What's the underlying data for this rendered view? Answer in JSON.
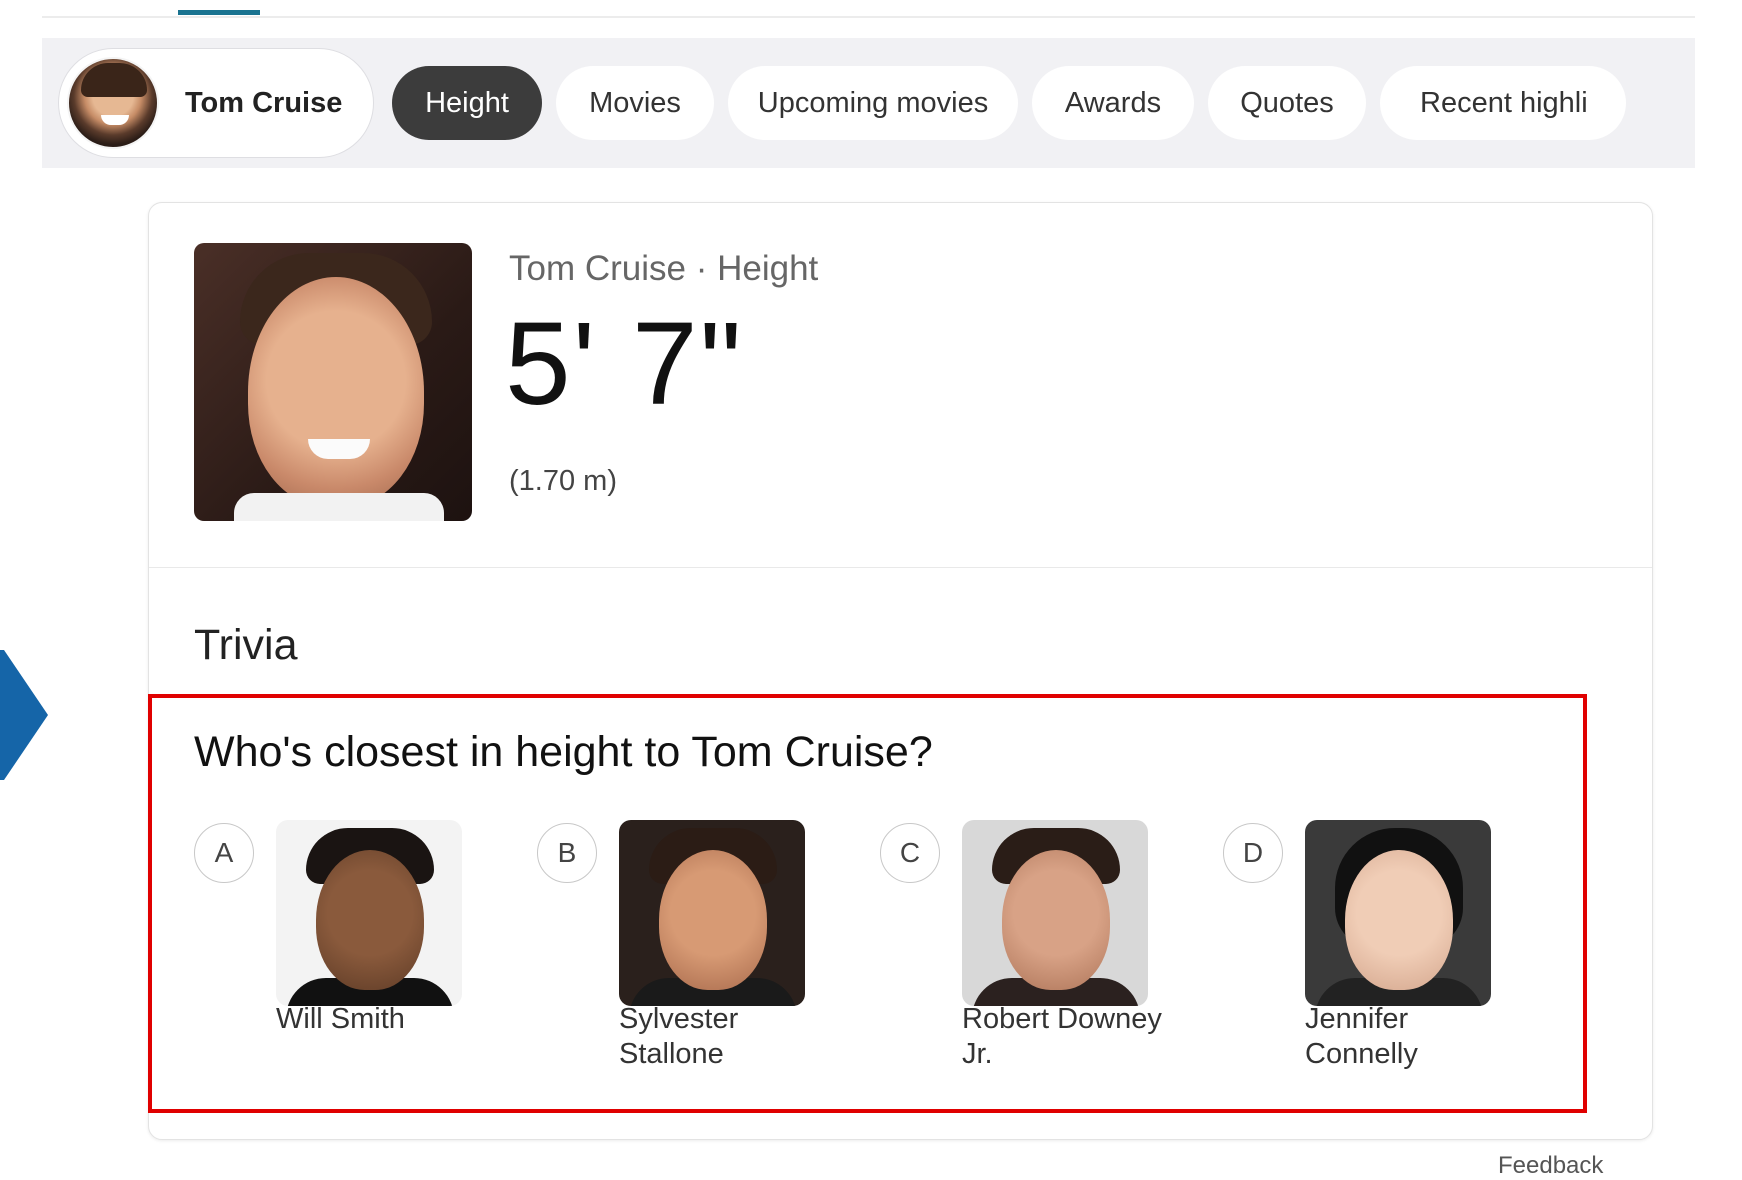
{
  "entity": {
    "name": "Tom Cruise"
  },
  "tabs": [
    {
      "label": "Height",
      "active": true
    },
    {
      "label": "Movies",
      "active": false
    },
    {
      "label": "Upcoming movies",
      "active": false
    },
    {
      "label": "Awards",
      "active": false
    },
    {
      "label": "Quotes",
      "active": false
    },
    {
      "label": "Recent highli",
      "active": false
    }
  ],
  "hero": {
    "caption": "Tom Cruise · Height",
    "value": "5' 7\"",
    "metric": "(1.70 m)"
  },
  "trivia": {
    "title": "Trivia",
    "question": "Who's closest in height to Tom Cruise?",
    "options": [
      {
        "letter": "A",
        "name": "Will Smith"
      },
      {
        "letter": "B",
        "name": "Sylvester Stallone"
      },
      {
        "letter": "C",
        "name": "Robert Downey Jr."
      },
      {
        "letter": "D",
        "name": "Jennifer Connelly"
      }
    ]
  },
  "footer": {
    "feedback": "Feedback"
  },
  "colors": {
    "active_tab": "#3c3c3c",
    "highlight_border": "#e00000",
    "accent_indicator": "#1a7390",
    "arrow": "#1565a8"
  }
}
